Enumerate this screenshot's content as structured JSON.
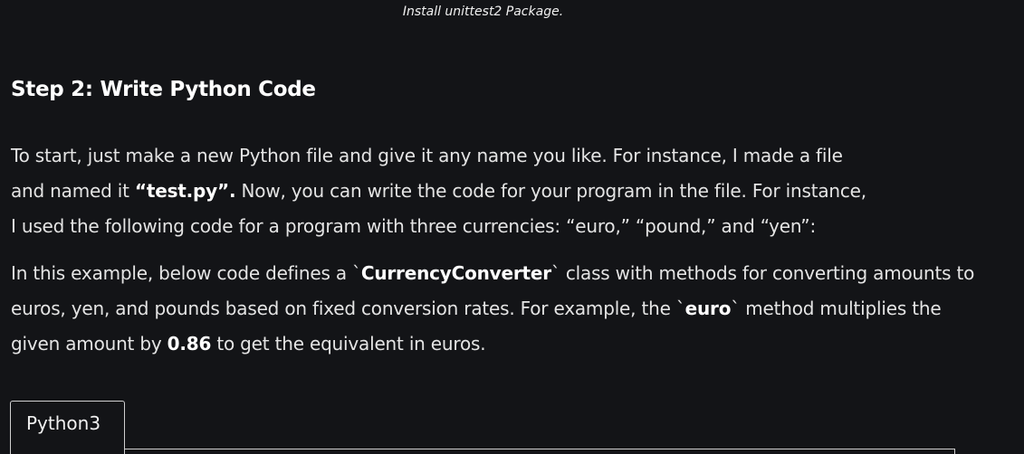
{
  "caption": "Install unittest2 Package.",
  "heading": "Step 2: Write Python Code",
  "para1": {
    "line1": "To start, just make a new Python file and give it any name you like. For instance, I made a file",
    "line2_a": "and named it ",
    "line2_bold": "“test.py”.",
    "line2_b": " Now, you can write the code for your program in the file. For instance,",
    "line3": "I used the following code for a program with three currencies: “euro,” “pound,” and “yen”:"
  },
  "para2": {
    "a": "In this example, below code defines a `",
    "bold1": "CurrencyConverter",
    "b": "` class with methods for converting amounts to euros, yen, and pounds based on fixed conversion rates. For example, the `",
    "bold2": "euro",
    "c": "` method multiplies the given amount by ",
    "bold3": "0.86",
    "d": " to get the equivalent in euros."
  },
  "code_tab": {
    "label": "Python3"
  }
}
